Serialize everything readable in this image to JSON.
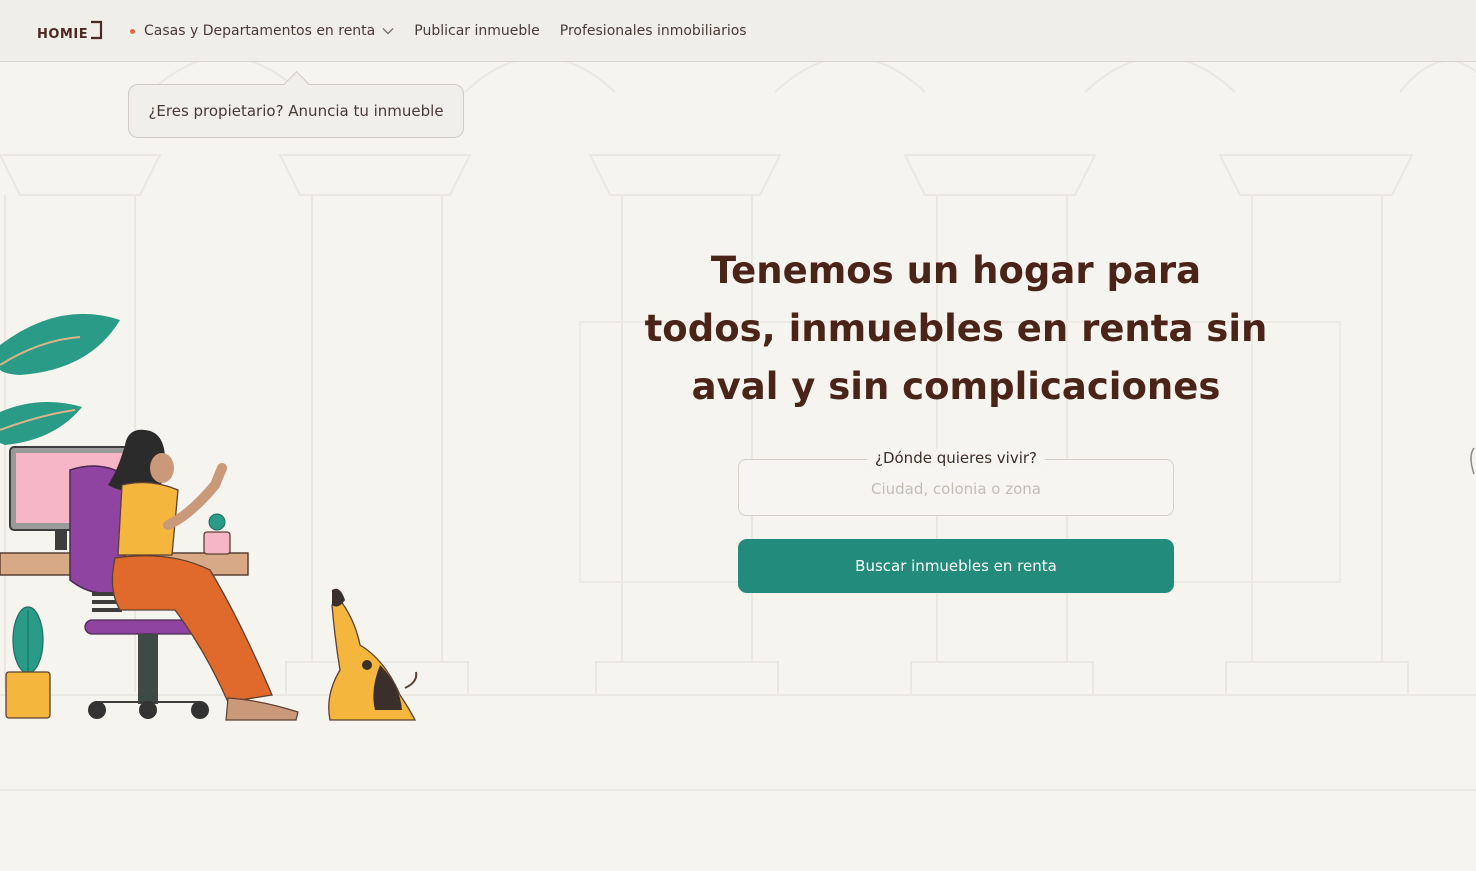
{
  "brand": {
    "logo_text": "HOMIE"
  },
  "nav": {
    "items": [
      {
        "label": "Casas y Departamentos en renta",
        "has_dot": true,
        "has_dropdown": true
      },
      {
        "label": "Publicar inmueble"
      },
      {
        "label": "Profesionales inmobiliarios"
      }
    ]
  },
  "tooltip": {
    "text": "¿Eres propietario? Anuncia tu inmueble"
  },
  "hero": {
    "title": "Tenemos un hogar para todos, inmuebles en renta sin aval y sin complicaciones"
  },
  "search": {
    "label": "¿Dónde quieres vivir?",
    "value": "",
    "placeholder": "Ciudad, colonia o zona",
    "button_label": "Buscar inmuebles en renta"
  },
  "theme": {
    "accent": "#228b7b",
    "nav_dot": "#e06a3b",
    "text": "#4a2418",
    "background": "#f5f4ef"
  }
}
